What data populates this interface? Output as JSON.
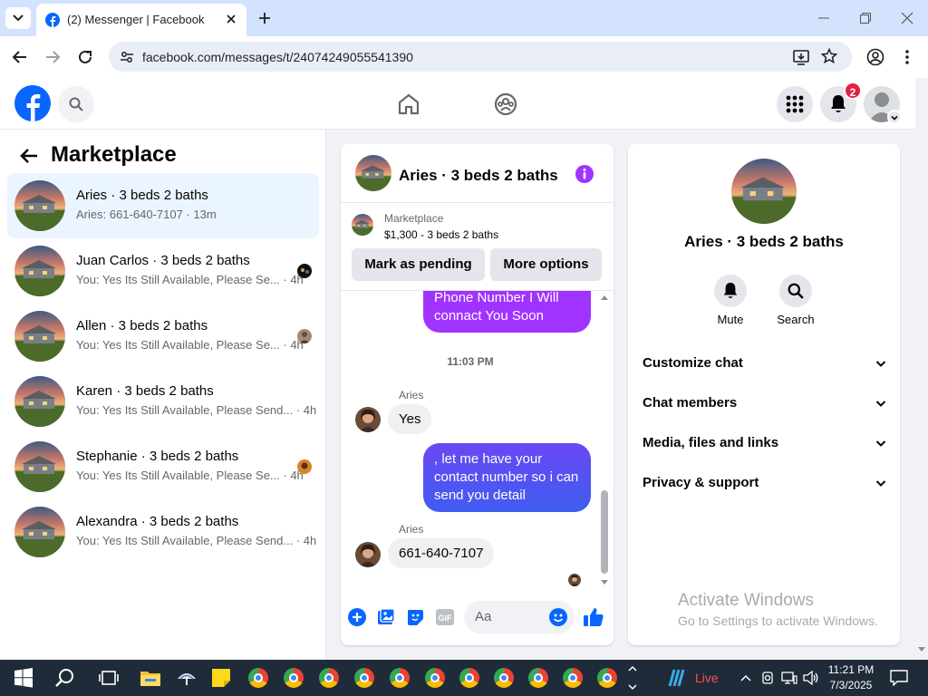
{
  "browser": {
    "tab_title": "(2) Messenger | Facebook",
    "url": "facebook.com/messages/t/24074249055541390"
  },
  "header": {
    "notification_count": "2"
  },
  "sidebar": {
    "title": "Marketplace",
    "conversations": [
      {
        "name": "Aries · 3 beds 2 baths",
        "preview": "Aries: 661-640-7107 · 13m",
        "active": true
      },
      {
        "name": "Juan Carlos · 3 beds 2 baths",
        "preview": "You: Yes Its Still Available, Please Se... · 4h"
      },
      {
        "name": "Allen · 3 beds 2 baths",
        "preview": "You: Yes Its Still Available, Please Se... · 4h"
      },
      {
        "name": "Karen · 3 beds 2 baths",
        "preview": "You: Yes Its Still Available, Please Send... · 4h"
      },
      {
        "name": "Stephanie · 3 beds 2 baths",
        "preview": "You: Yes Its Still Available, Please Se... · 4h"
      },
      {
        "name": "Alexandra · 3 beds 2 baths",
        "preview": "You: Yes Its Still Available, Please Send... · 4h"
      }
    ]
  },
  "chat": {
    "title": "Aries · 3 beds 2 baths",
    "product_source": "Marketplace",
    "product_desc": "$1,300 - 3 beds 2 baths",
    "mark_pending_label": "Mark as pending",
    "more_options_label": "More options",
    "messages": {
      "out1": "Phone Number I Will connact You Soon",
      "timestamp": "11:03 PM",
      "sender1": "Aries",
      "in1": "Yes",
      "out2": ", let me have your contact number so i can send you detail",
      "sender2": "Aries",
      "in2": "661-640-7107"
    },
    "composer_placeholder": "Aa",
    "accent": "#a033ff"
  },
  "details": {
    "title": "Aries · 3 beds 2 baths",
    "mute_label": "Mute",
    "search_label": "Search",
    "rows": [
      "Customize chat",
      "Chat members",
      "Media, files and links",
      "Privacy & support"
    ]
  },
  "watermark": {
    "line1": "Activate Windows",
    "line2": "Go to Settings to activate Windows."
  },
  "taskbar": {
    "weather_label": "Live",
    "time": "11:21 PM",
    "date": "7/3/2025"
  }
}
